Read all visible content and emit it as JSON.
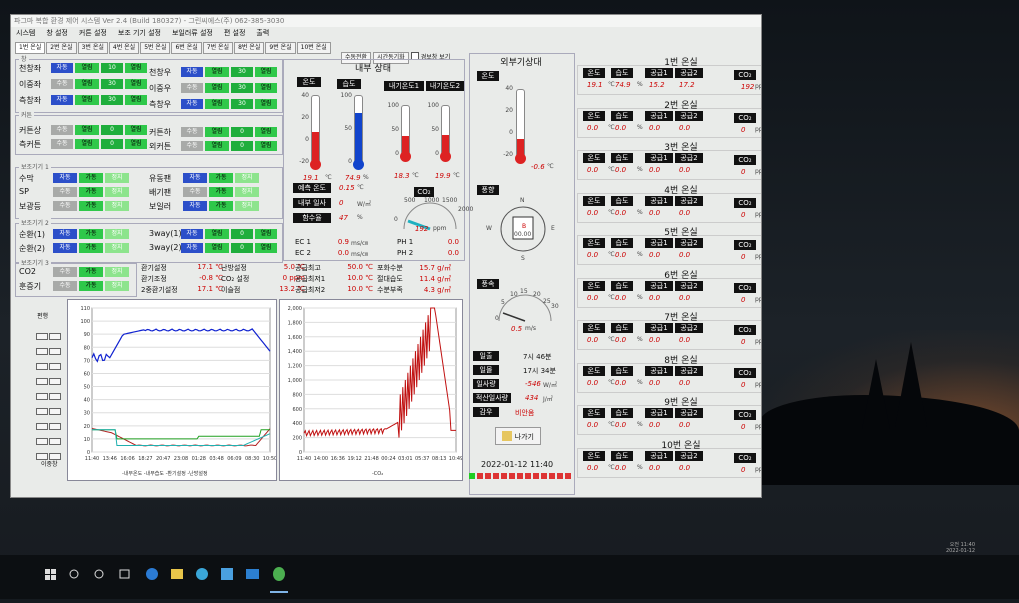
{
  "window": {
    "title": "파그마 복합 환경 제어 시스템 Ver 2.4 (Build 180327) - 그린씨에스(주) 062-385-3030"
  },
  "menu": [
    "시스템",
    "창 설정",
    "커튼 설정",
    "보조 기기 설정",
    "보일러류 설정",
    "편 설정",
    "출력"
  ],
  "tabs": [
    "1번 온실",
    "2번 온실",
    "3번 온실",
    "4번 온실",
    "5번 온실",
    "6번 온실",
    "7번 온실",
    "8번 온실",
    "9번 온실",
    "10번 온실"
  ],
  "tools": {
    "btn1": "수동전환",
    "btn2": "시간동기화",
    "alarm": "경보창 보기"
  },
  "window_group": {
    "title": "창",
    "rows": [
      {
        "name": "천창좌",
        "mode": "자동",
        "state": "열림",
        "value": "10",
        "btn": "열림"
      },
      {
        "name": "이중좌",
        "mode": "수동",
        "state": "열림",
        "value": "30",
        "btn": "열림"
      },
      {
        "name": "측창좌",
        "mode": "자동",
        "state": "열림",
        "value": "30",
        "btn": "열림"
      }
    ],
    "rows_r": [
      {
        "name": "천창우",
        "mode": "자동",
        "state": "열림",
        "value": "30",
        "btn": "열림"
      },
      {
        "name": "이중우",
        "mode": "수동",
        "state": "열림",
        "value": "30",
        "btn": "열림"
      },
      {
        "name": "측창우",
        "mode": "자동",
        "state": "열림",
        "value": "30",
        "btn": "열림"
      }
    ]
  },
  "curtain_group": {
    "title": "커튼",
    "rows": [
      {
        "name": "커튼상",
        "mode": "수동",
        "state": "열림",
        "value": "0",
        "btn": "열림"
      },
      {
        "name": "측커튼",
        "mode": "수동",
        "state": "열림",
        "value": "0",
        "btn": "열림"
      }
    ],
    "rows_r": [
      {
        "name": "커튼하",
        "mode": "수동",
        "state": "열림",
        "value": "0",
        "btn": "열림"
      },
      {
        "name": "외커튼",
        "mode": "수동",
        "state": "열림",
        "value": "0",
        "btn": "열림"
      }
    ]
  },
  "aux1": {
    "title": "보조기기 1",
    "rows": [
      {
        "name": "수막",
        "mode": "자동",
        "run": "가동",
        "stop": "정지"
      },
      {
        "name": "SP",
        "mode": "수동",
        "run": "가동",
        "stop": "정지"
      },
      {
        "name": "보광등",
        "mode": "수동",
        "run": "가동",
        "stop": "정지"
      }
    ],
    "rows_r": [
      {
        "name": "유동팬",
        "mode": "자동",
        "run": "가동",
        "stop": "정지"
      },
      {
        "name": "배기팬",
        "mode": "수동",
        "run": "가동",
        "stop": "정지"
      },
      {
        "name": "보일러",
        "mode": "자동",
        "run": "가동",
        "stop": "정지"
      }
    ]
  },
  "aux2": {
    "title": "보조기기 2",
    "rows": [
      {
        "name": "순환(1)",
        "mode": "자동",
        "run": "가동",
        "stop": "정지"
      },
      {
        "name": "순환(2)",
        "mode": "자동",
        "run": "가동",
        "stop": "정지"
      }
    ],
    "rows_r": [
      {
        "name": "3way(1)",
        "mode": "자동",
        "state": "열림",
        "value": "0",
        "btn": "열림"
      },
      {
        "name": "3way(2)",
        "mode": "자동",
        "state": "열림",
        "value": "0",
        "btn": "열림"
      }
    ]
  },
  "aux3": {
    "title": "보조기기 3",
    "rows": [
      {
        "name": "CO2",
        "mode": "수동",
        "run": "가동",
        "stop": "정지"
      },
      {
        "name": "훈증기",
        "mode": "수동",
        "run": "가동",
        "stop": "정지"
      }
    ]
  },
  "settings": {
    "rows": [
      [
        "환기설정",
        "17.1 ℃",
        "난방설정",
        "5.0 ℃",
        "공급최고",
        "50.0 ℃",
        "포화수분",
        "15.7 g/㎥"
      ],
      [
        "환기조정",
        "-0.8 ℃",
        "CO₂ 설정",
        "0 ppm",
        "공급최저1",
        "10.0 ℃",
        "절대습도",
        "11.4 g/㎥"
      ],
      [
        "2중환기설정",
        "17.1 ℃",
        "이슬점",
        "13.2 ℃",
        "공급최저2",
        "10.0 ℃",
        "수분부족",
        "4.3 g/㎥"
      ]
    ]
  },
  "side_labels": {
    "top": "편행",
    "bottom": "이중창"
  },
  "chart1": {
    "y_ticks": [
      "110",
      "100",
      "90",
      "80",
      "70",
      "60",
      "50",
      "40",
      "30",
      "20",
      "10",
      "0"
    ],
    "x_ticks": [
      "11:40",
      "13:46",
      "16:06",
      "18:27",
      "20:47",
      "23:08",
      "01:28",
      "03:48",
      "06:09",
      "08:30",
      "10:50"
    ],
    "legend": "-내부온도 -내부습도 -환기설정 -난방설정"
  },
  "chart2": {
    "y_ticks": [
      "2,000",
      "1,800",
      "1,600",
      "1,400",
      "1,200",
      "1,000",
      "800",
      "600",
      "400",
      "200",
      "0"
    ],
    "x_ticks": [
      "11:40",
      "14:00",
      "16:36",
      "19:12",
      "21:48",
      "00:24",
      "03:01",
      "05:37",
      "08:13",
      "10:49"
    ],
    "legend": "-CO₂"
  },
  "inner": {
    "title": "내부 상태",
    "temp_label": "온도",
    "hum_label": "습도",
    "temp": "19.1",
    "temp_unit": "℃",
    "hum": "74.9",
    "hum_unit": "%",
    "pipe1_label": "내기온도1",
    "pipe2_label": "내기온도2",
    "pipe1": "18.3",
    "pipe1_unit": "℃",
    "pipe2": "19.9",
    "pipe2_unit": "℃",
    "co2_label": "CO₂",
    "co2": "192",
    "co2_unit": "ppm",
    "gauge_ticks": [
      "500",
      "1000",
      "1500",
      "2000",
      "0"
    ],
    "thermo_ticks_t": [
      "40",
      "20",
      "0",
      "-20"
    ],
    "thermo_ticks_h": [
      "100",
      "50",
      "0"
    ],
    "thermo_ticks_p": [
      "100",
      "50",
      "0"
    ],
    "rows": [
      {
        "label": "예측 온도",
        "value": "0.15",
        "unit": "℃"
      },
      {
        "label": "내부 일사",
        "value": "0",
        "unit": "W/㎡"
      },
      {
        "label": "함수율",
        "value": "47",
        "unit": "%"
      }
    ],
    "ec1_label": "EC 1",
    "ec1": "0.9",
    "ec2_label": "EC 2",
    "ec2": "0.0",
    "ec_unit": "ms/㎝",
    "ph1_label": "PH 1",
    "ph1": "0.0",
    "ph2_label": "PH 2",
    "ph2": "0.0"
  },
  "outer": {
    "title": "외부기상대",
    "temp_label": "온도",
    "temp": "-0.6",
    "temp_unit": "℃",
    "thermo_ticks": [
      "40",
      "20",
      "0",
      "-20"
    ],
    "wind_dir_label": "풍향",
    "wind_dir_value": "00.00",
    "wind_n": "N",
    "wind_e": "E",
    "wind_s": "S",
    "wind_w": "W",
    "wind_b": "B",
    "wind_speed_label": "풍속",
    "wind_speed": "0.5",
    "wind_speed_unit": "m/s",
    "speed_ticks": [
      "5",
      "10",
      "15",
      "20",
      "25",
      "30",
      "0"
    ],
    "rows": [
      {
        "label": "일출",
        "value": "7시 46분"
      },
      {
        "label": "일몰",
        "value": "17시 34분"
      },
      {
        "label": "일사량",
        "value": "-546",
        "unit": "W/㎡"
      },
      {
        "label": "적산일사량",
        "value": "434",
        "unit": "J/㎡"
      },
      {
        "label": "감우",
        "value": "비안옴"
      }
    ],
    "exit": "나가기",
    "datetime": "2022-01-12 11:40"
  },
  "greenhouses": [
    {
      "title": "1번 온실",
      "t": "19.1",
      "h": "74.9",
      "s1": "15.2",
      "s2": "17.2",
      "co2": "192"
    },
    {
      "title": "2번 온실",
      "t": "0.0",
      "h": "0.0",
      "s1": "0.0",
      "s2": "0.0",
      "co2": "0"
    },
    {
      "title": "3번 온실",
      "t": "0.0",
      "h": "0.0",
      "s1": "0.0",
      "s2": "0.0",
      "co2": "0"
    },
    {
      "title": "4번 온실",
      "t": "0.0",
      "h": "0.0",
      "s1": "0.0",
      "s2": "0.0",
      "co2": "0"
    },
    {
      "title": "5번 온실",
      "t": "0.0",
      "h": "0.0",
      "s1": "0.0",
      "s2": "0.0",
      "co2": "0"
    },
    {
      "title": "6번 온실",
      "t": "0.0",
      "h": "0.0",
      "s1": "0.0",
      "s2": "0.0",
      "co2": "0"
    },
    {
      "title": "7번 온실",
      "t": "0.0",
      "h": "0.0",
      "s1": "0.0",
      "s2": "0.0",
      "co2": "0"
    },
    {
      "title": "8번 온실",
      "t": "0.0",
      "h": "0.0",
      "s1": "0.0",
      "s2": "0.0",
      "co2": "0"
    },
    {
      "title": "9번 온실",
      "t": "0.0",
      "h": "0.0",
      "s1": "0.0",
      "s2": "0.0",
      "co2": "0"
    },
    {
      "title": "10번 온실",
      "t": "0.0",
      "h": "0.0",
      "s1": "0.0",
      "s2": "0.0",
      "co2": "0"
    }
  ],
  "gh_labels": {
    "t": "온도",
    "h": "습도",
    "s1": "공급1",
    "s2": "공급2",
    "co2": "CO₂",
    "deg": "℃",
    "pct": "%",
    "ppm": "ppm"
  },
  "taskbar": {
    "time": "오전 11:40",
    "date": "2022-01-12"
  },
  "colors": {
    "blue": "#2c4fc9",
    "green": "#2fc84a",
    "red": "#cc0000",
    "black": "#111111"
  }
}
